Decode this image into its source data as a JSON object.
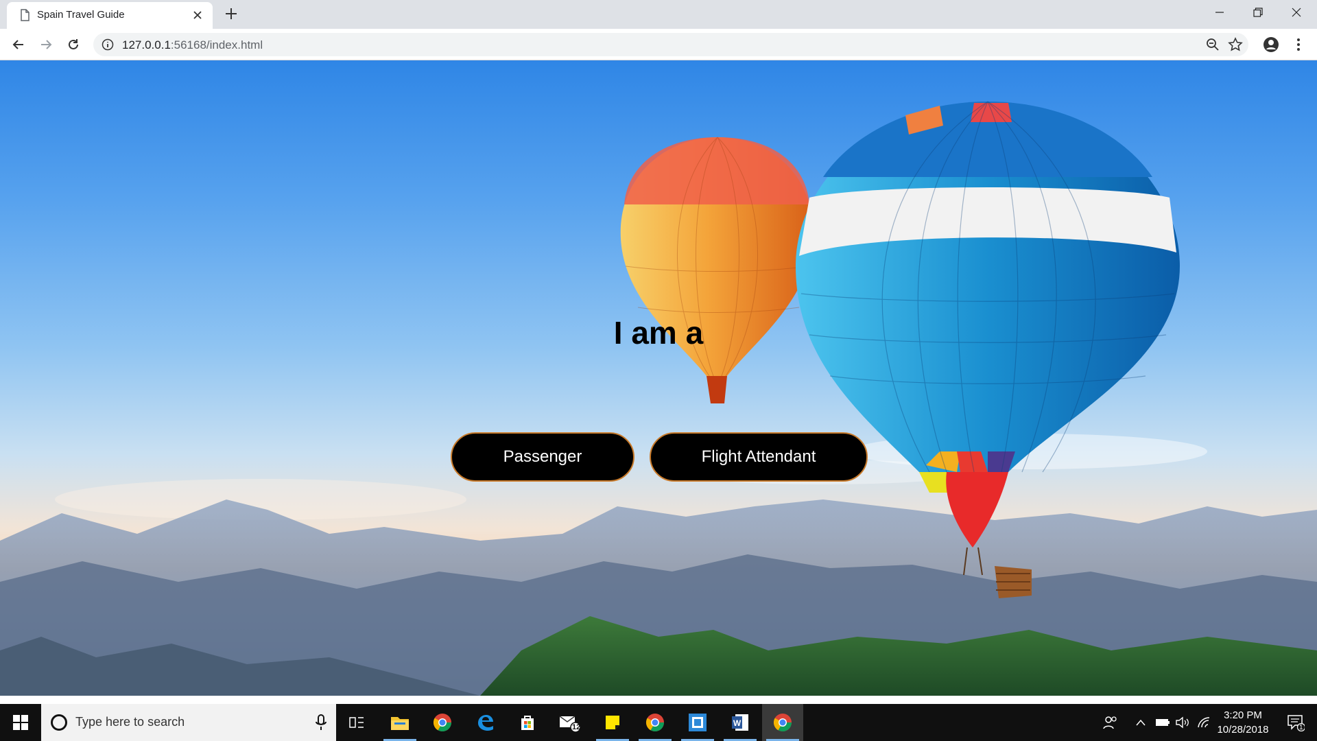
{
  "browser": {
    "tab_title": "Spain Travel Guide",
    "url_host": "127.0.0.1",
    "url_rest": ":56168/index.html"
  },
  "page": {
    "headline": "I am a",
    "buttons": {
      "passenger": "Passenger",
      "flight_attendant": "Flight Attendant"
    },
    "button_bg": "#000000",
    "button_border": "#c87a2a"
  },
  "taskbar": {
    "search_placeholder": "Type here to search",
    "mail_badge": "12",
    "time": "3:20 PM",
    "date": "10/28/2018",
    "notification_count": "1"
  }
}
